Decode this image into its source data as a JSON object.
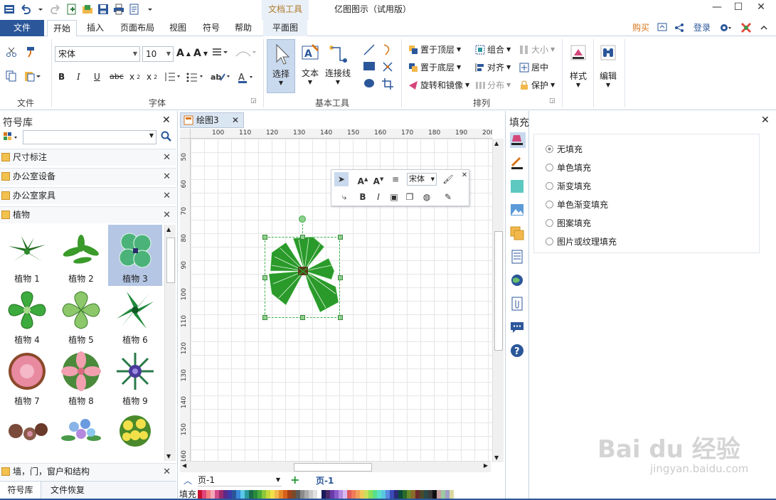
{
  "app": {
    "title": "亿图图示（试用版）",
    "contextual_tab_group": "文档工具"
  },
  "tabs": {
    "file": "文件",
    "home": "开始",
    "insert": "插入",
    "page_layout": "页面布局",
    "view": "视图",
    "symbol": "符号",
    "help": "帮助",
    "floor_plan": "平面图"
  },
  "topright": {
    "buy": "购买",
    "login": "登录"
  },
  "ribbon": {
    "font_name": "宋体",
    "font_size": "10",
    "groups": {
      "file": "文件",
      "font": "字体",
      "basic_tools": "基本工具",
      "arrange": "排列"
    },
    "select_label": "选择",
    "text_label": "文本",
    "connector_label": "连接线",
    "bring_to_front": "置于顶层",
    "send_to_back": "置于底层",
    "rotate_mirror": "旋转和镜像",
    "group": "组合",
    "align": "对齐",
    "distribute": "分布",
    "size": "大小",
    "center": "居中",
    "protect": "保护",
    "style": "样式",
    "edit": "编辑"
  },
  "left_panel": {
    "title": "符号库",
    "search_placeholder": "",
    "libraries": [
      "尺寸标注",
      "办公室设备",
      "办公室家具",
      "植物"
    ],
    "bottom_library": "墙，门，窗户和结构",
    "shapes": [
      {
        "label": "植物 1",
        "selected": false
      },
      {
        "label": "植物 2",
        "selected": false
      },
      {
        "label": "植物 3",
        "selected": true
      },
      {
        "label": "植物 4",
        "selected": false
      },
      {
        "label": "植物 5",
        "selected": false
      },
      {
        "label": "植物 6",
        "selected": false
      },
      {
        "label": "植物 7",
        "selected": false
      },
      {
        "label": "植物 8",
        "selected": false
      },
      {
        "label": "植物 9",
        "selected": false
      }
    ],
    "bottom_tabs": [
      "符号库",
      "文件恢复"
    ]
  },
  "document": {
    "tab": "绘图3",
    "hruler_ticks": [
      "100",
      "110",
      "120",
      "130",
      "140",
      "150",
      "160",
      "170",
      "180",
      "190",
      "200"
    ],
    "vruler_ticks": [
      "50",
      "60",
      "70",
      "80",
      "90",
      "100",
      "110",
      "120",
      "130",
      "140",
      "150",
      "160"
    ],
    "page_select": "页-1",
    "page_tab": "页-1",
    "palette_label": "填充"
  },
  "floating_toolbar": {
    "font": "宋体"
  },
  "fill_panel": {
    "title": "填充",
    "options": [
      "无填充",
      "单色填充",
      "渐变填充",
      "单色渐变填充",
      "图案填充",
      "图片或纹理填充"
    ],
    "selected_index": 0
  },
  "watermark": {
    "brand": "Bai du 经验",
    "url": "jingyan.baidu.com"
  },
  "colors": {
    "accent": "#2b579a",
    "selection": "#b4c6e4",
    "handle": "#3db04a"
  }
}
